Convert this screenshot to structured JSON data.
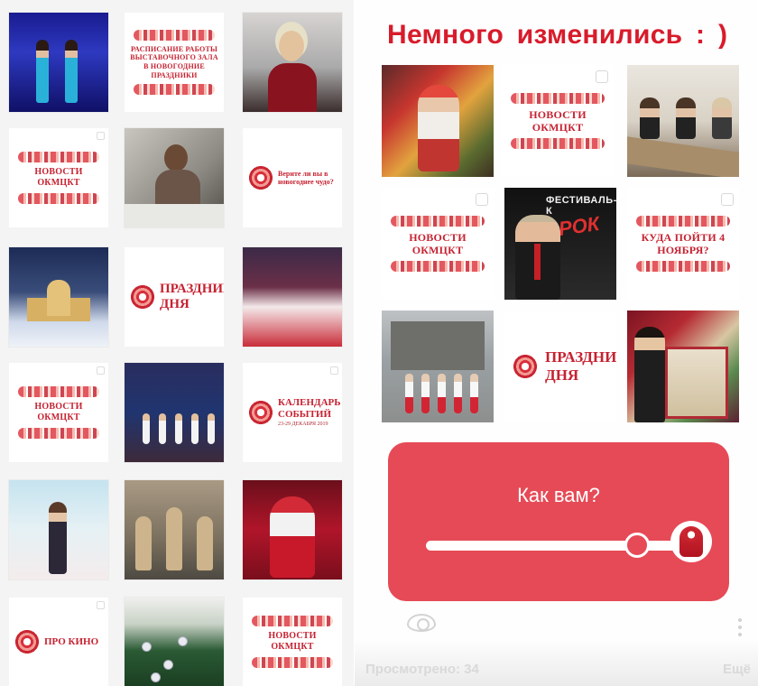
{
  "feed": {
    "cards": {
      "schedule": "РАСПИСАНИЕ РАБОТЫ ВЫСТАВОЧНОГО ЗАЛА В НОВОГОДНИЕ ПРАЗДНИКИ",
      "news1": "НОВОСТИ ОКМЦКТ",
      "miracle": "Верите ли вы в новогоднее чудо?",
      "holiday": "ПРАЗДНИК ДНЯ",
      "news2": "НОВОСТИ ОКМЦКТ",
      "calendar": "КАЛЕНДАРЬ СОБЫТИЙ",
      "calendar_dates": "23-29 ДЕКАБРЯ 2019",
      "movies": "ПРО КИНО",
      "news3": "НОВОСТИ ОКМЦКТ"
    }
  },
  "story": {
    "title": "Немного  изменились  : )",
    "cards": {
      "news1": "НОВОСТИ ОКМЦКТ",
      "news2": "НОВОСТИ ОКМЦКТ",
      "where": "КУДА ПОЙТИ 4 НОЯБРЯ?",
      "holiday": "ПРАЗДНИК ДНЯ",
      "festival_banner": "ФЕСТИВАЛЬ-К",
      "festival_rock": "РОК"
    },
    "poll": {
      "question": "Как вам?",
      "value": 0.83
    },
    "footer": {
      "viewed": "Просмотрено: 34",
      "more": "Ещё"
    }
  },
  "colors": {
    "accent": "#d81b2b",
    "poll": "#e64a56"
  }
}
